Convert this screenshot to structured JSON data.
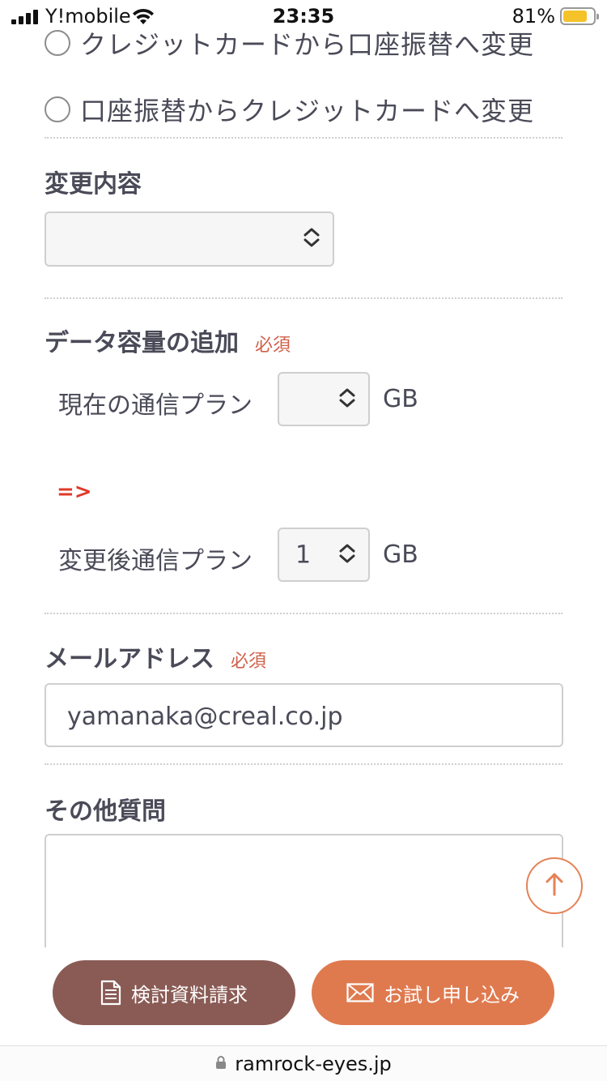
{
  "status_bar": {
    "carrier": "Y!mobile",
    "time": "23:35",
    "battery_percent": "81%",
    "battery_level": 0.81
  },
  "payment_change": {
    "options": [
      {
        "label": "クレジットカードから口座振替へ変更",
        "selected": false
      },
      {
        "label": "口座振替からクレジットカードへ変更",
        "selected": false
      }
    ]
  },
  "change_content": {
    "label": "変更内容",
    "value": ""
  },
  "data_capacity": {
    "label": "データ容量の追加",
    "required": "必須",
    "current_plan_label": "現在の通信プラン",
    "current_plan_value": "",
    "arrow": "=>",
    "new_plan_label": "変更後通信プラン",
    "new_plan_value": "1",
    "unit": "GB"
  },
  "email": {
    "label": "メールアドレス",
    "required": "必須",
    "value": "yamanaka@creal.co.jp"
  },
  "other_questions": {
    "label": "その他質問",
    "value": ""
  },
  "cta": {
    "brochure_label": "検討資料請求",
    "trial_label": "お試し申し込み"
  },
  "browser": {
    "url": "ramrock-eyes.jp"
  },
  "colors": {
    "required": "#d0604a",
    "arrow": "#e0382a",
    "brochure_button": "#8a5b55",
    "trial_button": "#df7a4f",
    "scroll_top_ring": "#e58256"
  }
}
